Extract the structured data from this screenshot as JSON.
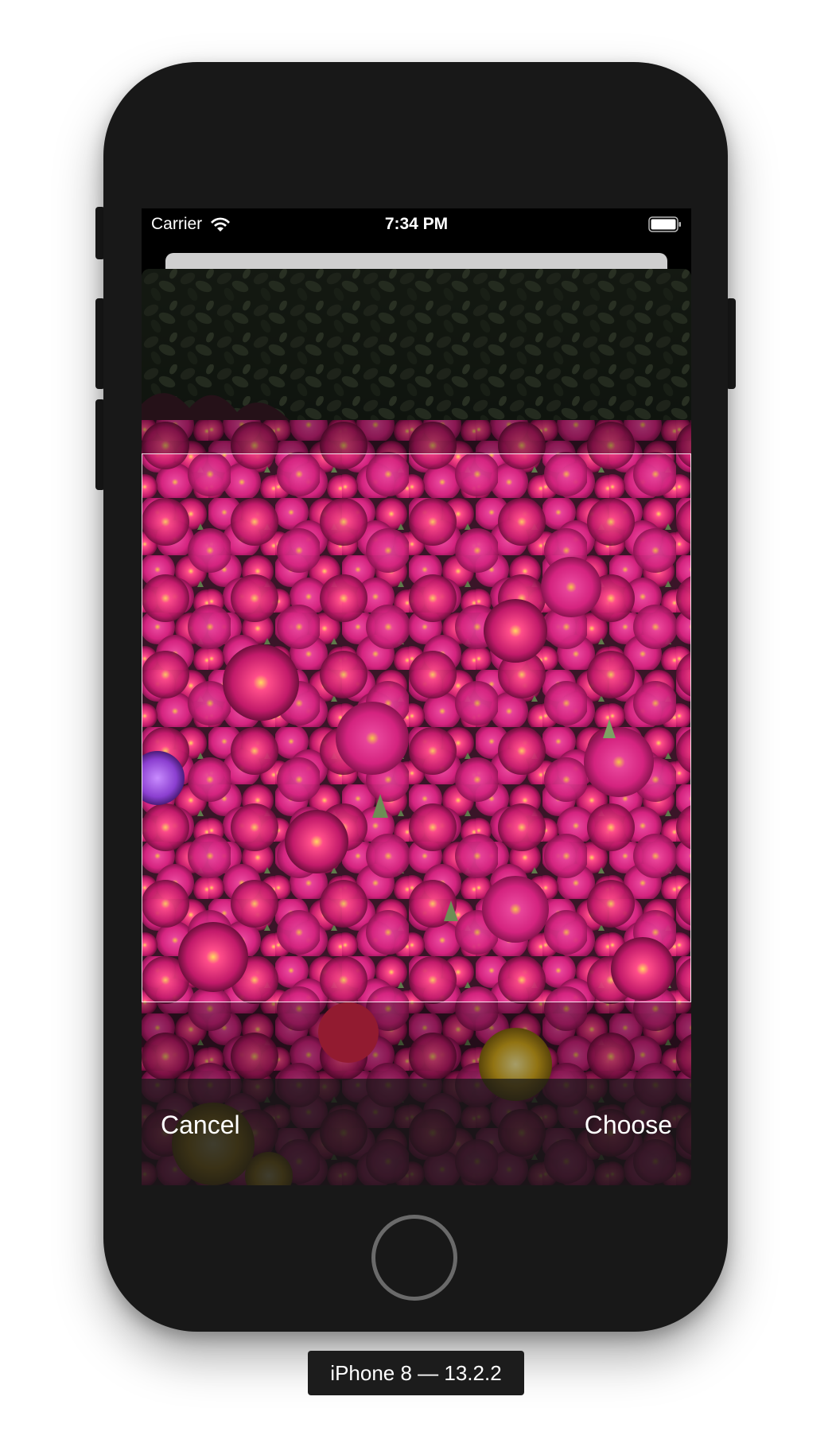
{
  "status_bar": {
    "carrier": "Carrier",
    "time": "7:34 PM",
    "wifi_icon": "wifi-icon",
    "battery_icon": "battery-icon"
  },
  "photo": {
    "description_icon": "flower-photo",
    "colors": {
      "foliage": "#2b3326",
      "flower_magenta": "#d4237f",
      "flower_pink": "#e8449a",
      "flower_yellow": "#e0b21e",
      "flower_purple": "#8b3fd0"
    }
  },
  "toolbar": {
    "cancel_label": "Cancel",
    "choose_label": "Choose"
  },
  "device": {
    "label": "iPhone 8 — 13.2.2"
  }
}
